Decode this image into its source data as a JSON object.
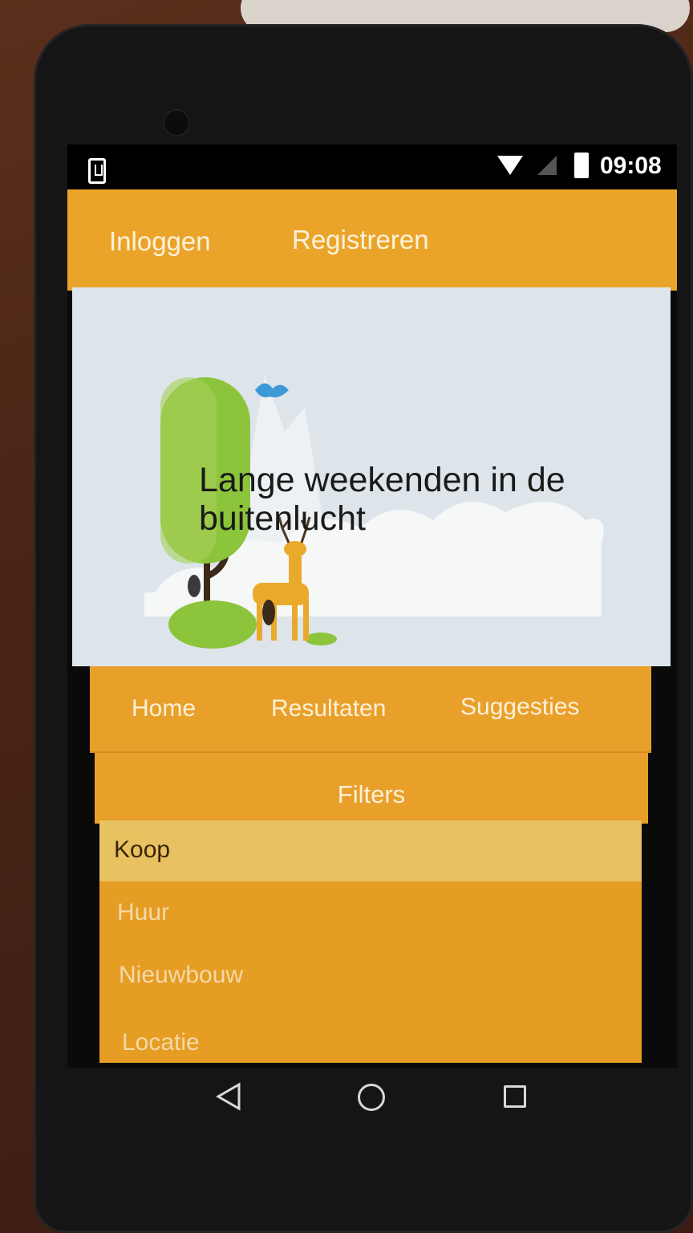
{
  "status_bar": {
    "time": "09:08",
    "icons": [
      "download-icon",
      "wifi-icon",
      "no-signal-icon",
      "battery-charging-icon"
    ]
  },
  "header": {
    "login_label": "Inloggen",
    "register_label": "Registreren"
  },
  "hero": {
    "title": "Lange weekenden in de buitenlucht"
  },
  "nav": {
    "tabs": [
      {
        "label": "Home"
      },
      {
        "label": "Resultaten"
      },
      {
        "label": "Suggesties"
      }
    ]
  },
  "filters": {
    "heading": "Filters",
    "items": [
      {
        "label": "Koop",
        "selected": true
      },
      {
        "label": "Huur",
        "selected": false
      },
      {
        "label": "Nieuwbouw",
        "selected": false
      },
      {
        "label": "Locatie",
        "selected": false
      }
    ]
  },
  "system_nav": {
    "icons": [
      "back-icon",
      "home-icon",
      "recents-icon"
    ]
  },
  "colors": {
    "header_bg": "#eba42a",
    "selected_filter_bg": "#e8c261",
    "list_bg": "#e69d24"
  }
}
